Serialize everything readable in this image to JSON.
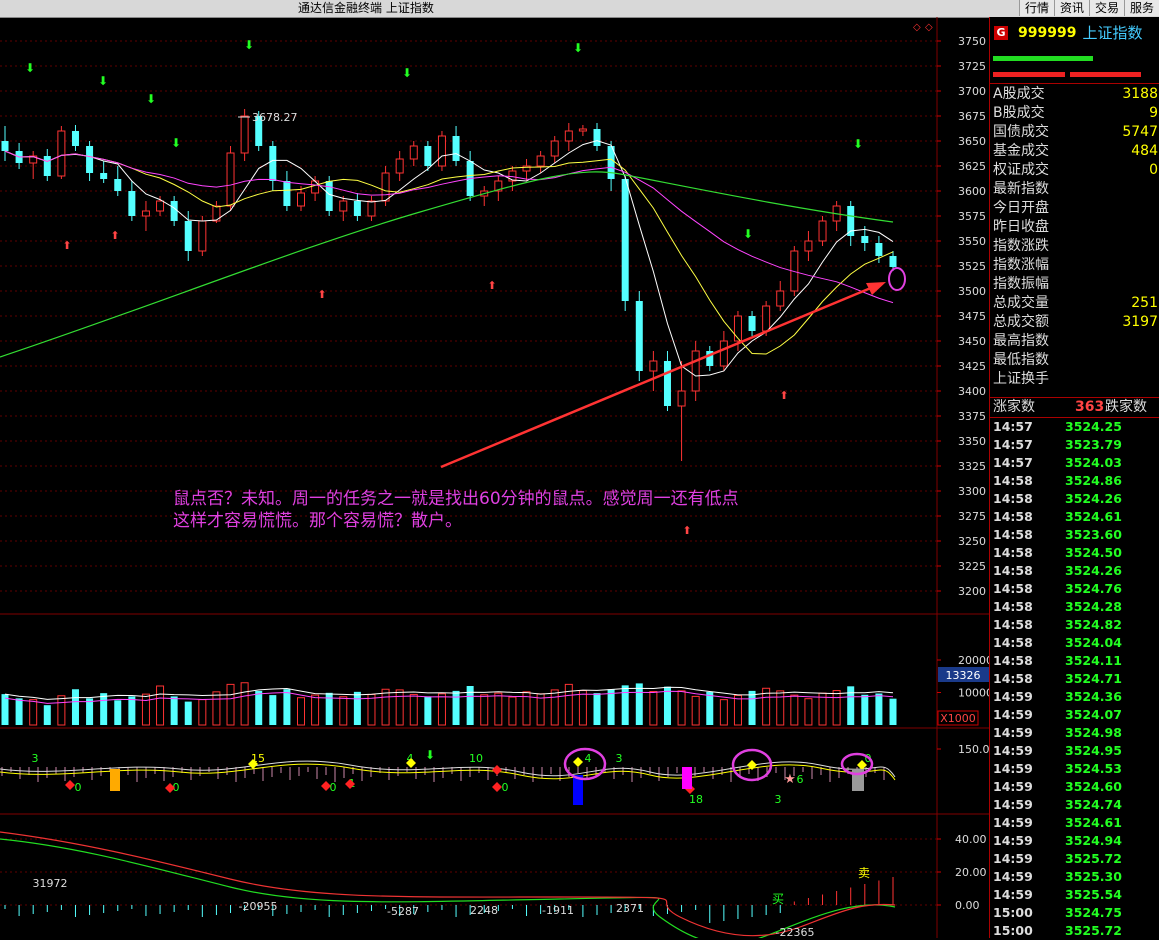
{
  "window": {
    "title": "通达信金融终端   上证指数",
    "buttons": [
      "行情",
      "资讯",
      "交易",
      "服务"
    ]
  },
  "colors": {
    "up": "#ff3333",
    "down": "#54ffff",
    "ma5": "#ffffff",
    "ma10": "#ffff44",
    "ma20": "#ff44ff",
    "ma60": "#33dd33",
    "grid": "#800000",
    "annotation": "#e040e0"
  },
  "price_axis": {
    "ticks": [
      "3750",
      "3725",
      "3700",
      "3675",
      "3650",
      "3625",
      "3600",
      "3575",
      "3550",
      "3525",
      "3500",
      "3475",
      "3450",
      "3425",
      "3400",
      "3375",
      "3350",
      "3325",
      "3300",
      "3275",
      "3250",
      "3225",
      "3200"
    ]
  },
  "volume_axis": {
    "ticks": [
      "20000",
      "10000"
    ],
    "current": "13326",
    "unit": "X1000"
  },
  "indicator_axis": {
    "ticks": [
      "150.0"
    ]
  },
  "macd_axis": {
    "ticks": [
      "40.00",
      "20.00",
      "0.00"
    ]
  },
  "high_label": "3678.27",
  "annotation_text": [
    "鼠点否？未知。周一的任务之一就是找出60分钟的鼠点。感觉周一还有低点",
    "这样才容易慌慌。那个容易慌？散户。"
  ],
  "indicator_labels": [
    "3",
    "15",
    "4",
    "10",
    "3",
    "0",
    "0",
    "0",
    "1",
    "0",
    "4",
    "18",
    "3",
    "6",
    "0"
  ],
  "macd_labels": [
    "31972",
    "-20955",
    "-5287",
    "2248",
    "-1911",
    "2371",
    "-22365"
  ],
  "macd_signals": {
    "buy": "买",
    "sell": "卖"
  },
  "chart_data": {
    "type": "candlestick",
    "interval": "60min",
    "ylim": [
      3190,
      3760
    ],
    "candles": [
      [
        3650,
        3665,
        3630,
        3640
      ],
      [
        3640,
        3648,
        3622,
        3628
      ],
      [
        3628,
        3640,
        3612,
        3635
      ],
      [
        3635,
        3642,
        3610,
        3615
      ],
      [
        3615,
        3665,
        3612,
        3660
      ],
      [
        3660,
        3666,
        3640,
        3645
      ],
      [
        3645,
        3650,
        3610,
        3618
      ],
      [
        3618,
        3630,
        3608,
        3612
      ],
      [
        3612,
        3625,
        3595,
        3600
      ],
      [
        3600,
        3610,
        3570,
        3575
      ],
      [
        3575,
        3590,
        3560,
        3580
      ],
      [
        3580,
        3595,
        3575,
        3590
      ],
      [
        3590,
        3595,
        3565,
        3570
      ],
      [
        3570,
        3580,
        3530,
        3540
      ],
      [
        3540,
        3575,
        3535,
        3570
      ],
      [
        3570,
        3590,
        3568,
        3585
      ],
      [
        3585,
        3645,
        3580,
        3638
      ],
      [
        3638,
        3682,
        3630,
        3675
      ],
      [
        3675,
        3680,
        3640,
        3645
      ],
      [
        3645,
        3650,
        3600,
        3610
      ],
      [
        3610,
        3620,
        3580,
        3585
      ],
      [
        3585,
        3605,
        3580,
        3598
      ],
      [
        3598,
        3615,
        3590,
        3610
      ],
      [
        3610,
        3615,
        3575,
        3580
      ],
      [
        3580,
        3595,
        3570,
        3590
      ],
      [
        3590,
        3598,
        3570,
        3575
      ],
      [
        3575,
        3595,
        3570,
        3590
      ],
      [
        3590,
        3625,
        3585,
        3618
      ],
      [
        3618,
        3640,
        3610,
        3632
      ],
      [
        3632,
        3650,
        3625,
        3645
      ],
      [
        3645,
        3650,
        3620,
        3625
      ],
      [
        3625,
        3660,
        3620,
        3655
      ],
      [
        3655,
        3665,
        3625,
        3630
      ],
      [
        3630,
        3640,
        3590,
        3595
      ],
      [
        3595,
        3605,
        3585,
        3600
      ],
      [
        3600,
        3615,
        3590,
        3610
      ],
      [
        3610,
        3625,
        3600,
        3620
      ],
      [
        3620,
        3632,
        3610,
        3625
      ],
      [
        3625,
        3640,
        3618,
        3635
      ],
      [
        3635,
        3655,
        3628,
        3650
      ],
      [
        3650,
        3668,
        3640,
        3660
      ],
      [
        3660,
        3666,
        3655,
        3662
      ],
      [
        3662,
        3668,
        3640,
        3645
      ],
      [
        3645,
        3650,
        3600,
        3612
      ],
      [
        3612,
        3615,
        3480,
        3490
      ],
      [
        3490,
        3500,
        3410,
        3420
      ],
      [
        3420,
        3440,
        3400,
        3430
      ],
      [
        3430,
        3440,
        3380,
        3385
      ],
      [
        3385,
        3430,
        3330,
        3400
      ],
      [
        3400,
        3450,
        3390,
        3440
      ],
      [
        3440,
        3445,
        3420,
        3425
      ],
      [
        3425,
        3460,
        3420,
        3450
      ],
      [
        3450,
        3480,
        3440,
        3475
      ],
      [
        3475,
        3480,
        3455,
        3460
      ],
      [
        3460,
        3490,
        3455,
        3485
      ],
      [
        3485,
        3510,
        3480,
        3500
      ],
      [
        3500,
        3545,
        3495,
        3540
      ],
      [
        3540,
        3560,
        3530,
        3550
      ],
      [
        3550,
        3575,
        3545,
        3570
      ],
      [
        3570,
        3590,
        3560,
        3585
      ],
      [
        3585,
        3590,
        3545,
        3555
      ],
      [
        3555,
        3565,
        3540,
        3548
      ],
      [
        3548,
        3555,
        3528,
        3535
      ],
      [
        3535,
        3540,
        3520,
        3524
      ]
    ],
    "volume": [
      9500,
      8200,
      7800,
      6100,
      9000,
      11000,
      8200,
      9800,
      7600,
      8800,
      9500,
      12000,
      8800,
      7200,
      7800,
      10200,
      12500,
      13000,
      10500,
      9200,
      11000,
      8400,
      9200,
      9900,
      8700,
      10200,
      9400,
      11000,
      10800,
      9400,
      8800,
      9600,
      10500,
      12000,
      9300,
      9800,
      8600,
      10200,
      9600,
      10800,
      12500,
      10600,
      9800,
      11000,
      12200,
      12800,
      10300,
      11800,
      10500,
      8800,
      10200,
      7800,
      9100,
      10500,
      11300,
      10500,
      9200,
      8100,
      9800,
      10600,
      11900,
      9300,
      9700,
      8100
    ]
  }
}
